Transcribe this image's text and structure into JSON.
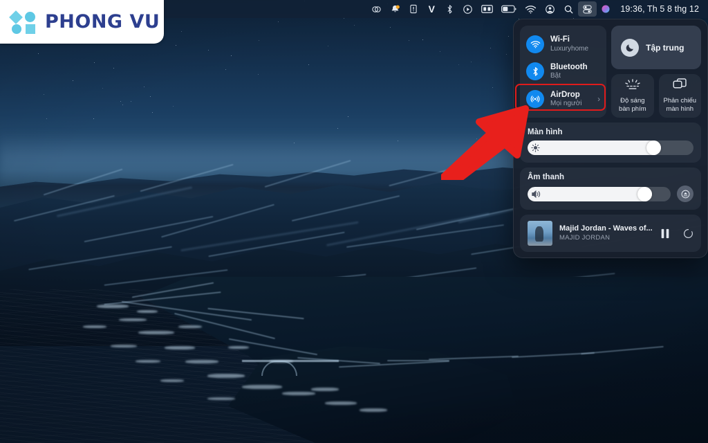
{
  "wallpaper": {
    "name": "Big Sur night coastline",
    "sky_color": "#1b3f63",
    "ocean_color": "#10375a"
  },
  "logo": {
    "text": "PHONG VU",
    "text_color": "#2d3f8f",
    "mark_color": "#5ec8e4",
    "background": "#ffffff"
  },
  "menubar": {
    "background": "rgba(18,33,54,.78)",
    "clock": "19:36, Th 5 8 thg 12",
    "items": [
      {
        "name": "creative-cloud-icon",
        "label": "Creative Cloud"
      },
      {
        "name": "notification-bell-icon",
        "label": "Notifications",
        "badge_color": "#f5a623"
      },
      {
        "name": "alert-box-icon",
        "label": "Alert"
      },
      {
        "name": "letter-v-icon",
        "label": "V"
      },
      {
        "name": "bluetooth-icon",
        "label": "Bluetooth"
      },
      {
        "name": "play-circle-icon",
        "label": "Player"
      },
      {
        "name": "display-icon",
        "label": "Display"
      },
      {
        "name": "battery-icon",
        "label": "Battery"
      },
      {
        "name": "wifi-icon",
        "label": "Wi-Fi"
      },
      {
        "name": "user-account-icon",
        "label": "Fast User Switching"
      },
      {
        "name": "search-icon",
        "label": "Spotlight"
      },
      {
        "name": "control-center-icon",
        "label": "Trung tâm điều khiển",
        "active": true
      },
      {
        "name": "siri-icon",
        "label": "Siri"
      }
    ]
  },
  "control_center": {
    "highlight_color": "#e01b1b",
    "connectivity": [
      {
        "icon": "wifi-icon",
        "title": "Wi-Fi",
        "subtitle": "Luxuryhome",
        "active": true,
        "chevron": ""
      },
      {
        "icon": "bluetooth-icon",
        "title": "Bluetooth",
        "subtitle": "Bật",
        "active": true,
        "chevron": ""
      },
      {
        "icon": "airdrop-icon",
        "title": "AirDrop",
        "subtitle": "Mọi người",
        "active": true,
        "chevron": "›",
        "highlighted": true
      }
    ],
    "focus": {
      "icon": "moon-icon",
      "label": "Tập trung"
    },
    "mini_tiles": [
      {
        "icon": "keyboard-brightness-icon",
        "label": "Độ sáng\nbàn phím",
        "line1": "Độ sáng",
        "line2": "bàn phím"
      },
      {
        "icon": "screen-mirroring-icon",
        "label": "Phản chiếu\nmàn hình",
        "line1": "Phản chiếu",
        "line2": "màn hình"
      }
    ],
    "display_slider": {
      "title": "Màn hình",
      "icon": "brightness-icon",
      "value": 81
    },
    "sound_slider": {
      "title": "Âm thanh",
      "icon": "speaker-icon",
      "value": 88,
      "airplay_icon": "airplay-icon"
    },
    "now_playing": {
      "title": "Majid Jordan - Waves of...",
      "artist": "MAJID JORDAN",
      "art_name": "album-artwork",
      "pause_icon": "pause-icon",
      "shuffle_icon": "loading-spinner-icon"
    }
  },
  "annotation": {
    "arrow_color": "#e8201c",
    "arrow_name": "red-pointer-arrow",
    "points_to": "AirDrop"
  }
}
